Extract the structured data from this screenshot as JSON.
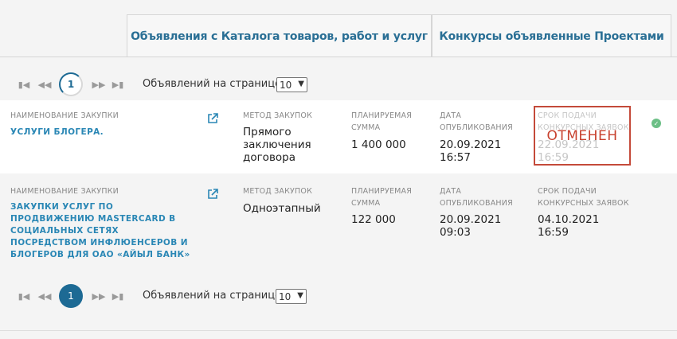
{
  "tabs": [
    {
      "label": "Объявления с Каталога товаров, работ и услуг"
    },
    {
      "label": "Конкурсы объявленные Проектами"
    }
  ],
  "pager_top": {
    "current_page": "1",
    "per_page_label": "Объявлений на странице",
    "per_page_value": "10"
  },
  "pager_bottom": {
    "current_page": "1",
    "per_page_label": "Объявлений на странице",
    "per_page_value": "10"
  },
  "labels": {
    "name": "Наименование закупки",
    "method": "Метод закупок",
    "planned_sum": "Планируемая сумма",
    "published_date": "Дата опубликования",
    "deadline": "Срок подачи конкурсных заявок"
  },
  "rows": [
    {
      "title": "Услуги блогера.",
      "method": "Прямого заключения договора",
      "sum": "1 400 000",
      "published": "20.09.2021 16:57",
      "deadline": "22.09.2021 16:59",
      "stamp": "ОТМЕНЕН",
      "status_icon": "check-circle-icon"
    },
    {
      "title": "Закупки услуг по продвижению MASTERCARD в социальных сетях посредством инфлюенсеров и блогеров для ОАО «Айыл Банк»",
      "method": "Одноэтапный",
      "sum": "122 000",
      "published": "20.09.2021 09:03",
      "deadline": "04.10.2021 16:59"
    }
  ],
  "colors": {
    "accent": "#2a87b5",
    "tab_text": "#2a6f95",
    "stamp": "#c8422f",
    "pager_active": "#1d6a94",
    "ok": "#6cbf86"
  }
}
